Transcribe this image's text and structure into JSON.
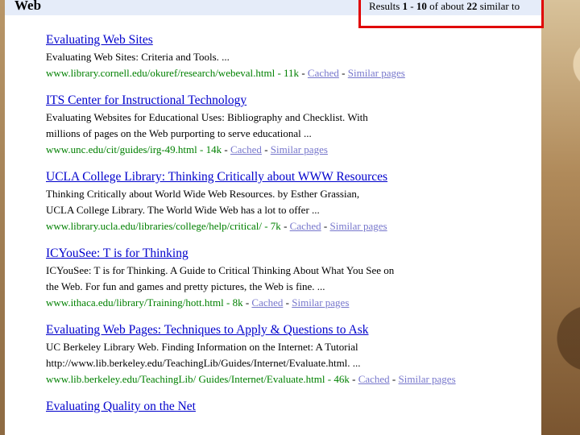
{
  "header": {
    "title": "Web",
    "stats": {
      "prefix": "Results ",
      "start": "1",
      "dash": " - ",
      "end": "10",
      "mid": " of about ",
      "total": "22",
      "suffix": " similar to"
    }
  },
  "colors": {
    "header_bg": "#e5ecf9",
    "link": "#0000cc",
    "url_green": "#008000",
    "highlight": "#e00000"
  },
  "results": [
    {
      "title": "Evaluating Web Sites",
      "snippet": [
        "Evaluating Web Sites: Criteria and Tools. ..."
      ],
      "url": "www.library.cornell.edu/okuref/research/webeval.html",
      "size": " - 11k",
      "cached": "Cached",
      "similar": "Similar pages"
    },
    {
      "title": "ITS Center for Instructional Technology",
      "snippet": [
        "Evaluating Websites for Educational Uses: Bibliography and Checklist. With",
        "millions of pages on the Web purporting to serve educational ..."
      ],
      "url": "www.unc.edu/cit/guides/irg-49.html",
      "size": " - 14k",
      "cached": "Cached",
      "similar": "Similar pages"
    },
    {
      "title": "UCLA College Library: Thinking Critically about WWW Resources",
      "snippet": [
        "Thinking Critically about World Wide Web Resources. by Esther Grassian,",
        "UCLA College Library. The World Wide Web has a lot to offer ..."
      ],
      "url": "www.library.ucla.edu/libraries/college/help/critical/",
      "size": " - 7k",
      "cached": "Cached",
      "similar": "Similar pages"
    },
    {
      "title": "ICYouSee: T is for Thinking",
      "snippet": [
        "ICYouSee: T is for Thinking. A Guide to Critical Thinking About What You See on",
        "the Web. For fun and games and pretty pictures, the Web is fine. ..."
      ],
      "url": "www.ithaca.edu/library/Training/hott.html",
      "size": " - 8k",
      "cached": "Cached",
      "similar": "Similar pages"
    },
    {
      "title": "Evaluating Web Pages: Techniques to Apply & Questions to Ask",
      "snippet": [
        "UC Berkeley Library Web. Finding Information on the Internet: A Tutorial",
        "http://www.lib.berkeley.edu/TeachingLib/Guides/Internet/Evaluate.html. ..."
      ],
      "url": "www.lib.berkeley.edu/TeachingLib/ Guides/Internet/Evaluate.html",
      "size": " - 46k",
      "cached": "Cached",
      "similar": "Similar pages"
    },
    {
      "title": "Evaluating Quality on the Net",
      "snippet": [],
      "url": "",
      "size": "",
      "cached": "",
      "similar": ""
    }
  ]
}
